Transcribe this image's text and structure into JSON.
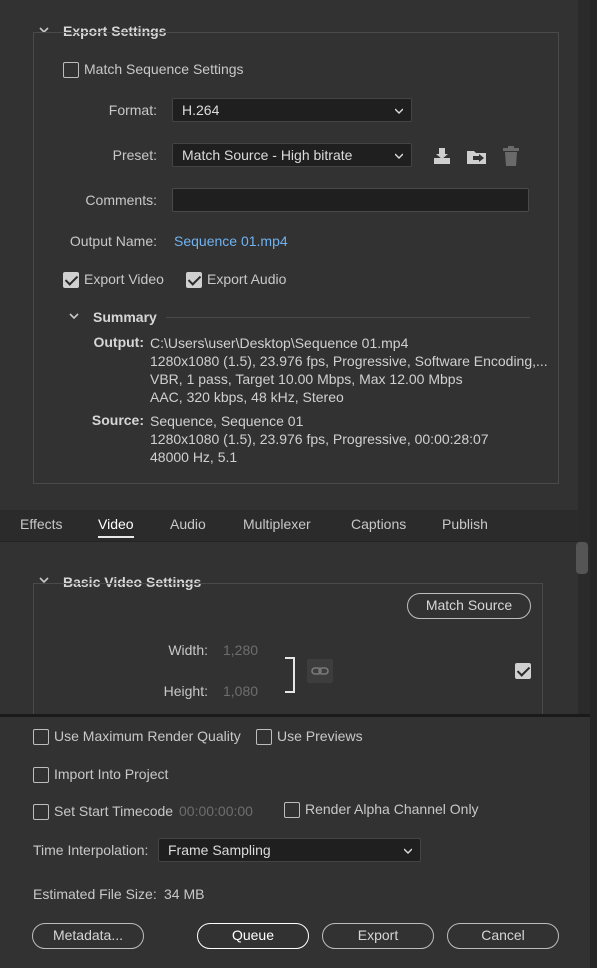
{
  "export_settings": {
    "heading": "Export Settings",
    "match_sequence": "Match Sequence Settings",
    "format_label": "Format:",
    "format_value": "H.264",
    "preset_label": "Preset:",
    "preset_value": "Match Source - High bitrate",
    "comments_label": "Comments:",
    "comments_value": "",
    "output_name_label": "Output Name:",
    "output_name_value": "Sequence 01.mp4",
    "export_video": "Export Video",
    "export_audio": "Export Audio",
    "icons": [
      "save-preset-icon",
      "import-preset-icon",
      "delete-preset-icon"
    ]
  },
  "summary": {
    "heading": "Summary",
    "output_label": "Output:",
    "output_lines": [
      "C:\\Users\\user\\Desktop\\Sequence 01.mp4",
      "1280x1080 (1.5), 23.976 fps, Progressive, Software Encoding,...",
      "VBR, 1 pass, Target 10.00 Mbps, Max 12.00 Mbps",
      "AAC, 320 kbps, 48 kHz, Stereo"
    ],
    "source_label": "Source:",
    "source_lines": [
      "Sequence, Sequence 01",
      "1280x1080 (1.5), 23.976 fps, Progressive, 00:00:28:07",
      "48000 Hz, 5.1"
    ]
  },
  "tabs": [
    "Effects",
    "Video",
    "Audio",
    "Multiplexer",
    "Captions",
    "Publish"
  ],
  "active_tab": "Video",
  "basic_video": {
    "heading": "Basic Video Settings",
    "match_source": "Match Source",
    "width_label": "Width:",
    "width_value": "1,280",
    "height_label": "Height:",
    "height_value": "1,080"
  },
  "bottom": {
    "max_render_quality": "Use Maximum Render Quality",
    "use_previews": "Use Previews",
    "import_into_project": "Import Into Project",
    "set_start_timecode": "Set Start Timecode",
    "timecode_value": "00:00:00:00",
    "render_alpha": "Render Alpha Channel Only",
    "time_interp_label": "Time Interpolation:",
    "time_interp_value": "Frame Sampling",
    "file_size_label": "Estimated File Size:",
    "file_size_value": "34 MB",
    "metadata_button": "Metadata...",
    "queue_button": "Queue",
    "export_button": "Export",
    "cancel_button": "Cancel"
  },
  "colors": {
    "background": "#323232",
    "link": "#6fb3f2",
    "field": "#1f1f1f"
  }
}
